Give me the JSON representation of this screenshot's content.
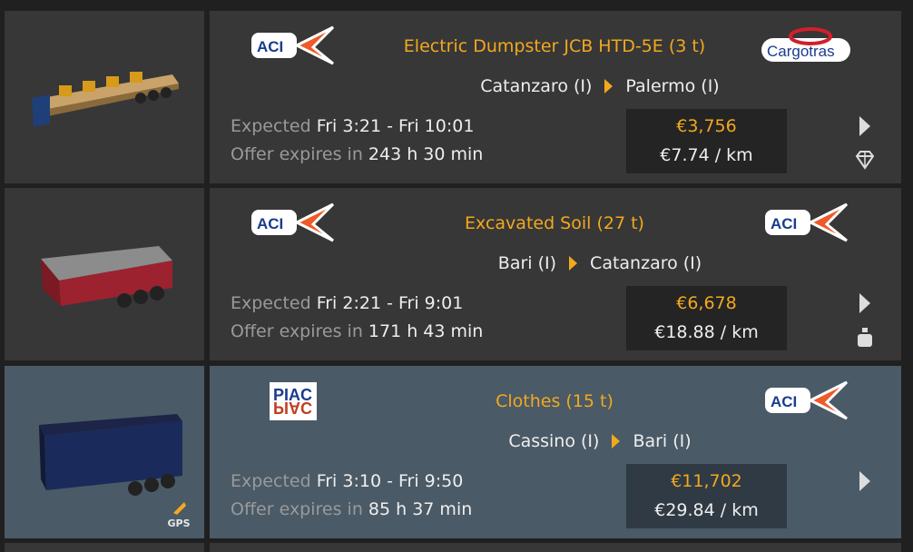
{
  "jobs": [
    {
      "cargo": "Electric Dumpster JCB HTD-5E (3 t)",
      "from": "Catanzaro (I)",
      "to": "Palermo (I)",
      "expected_label": "Expected",
      "expected_value": "Fri 3:21 - Fri 10:01",
      "expires_label": "Offer expires in",
      "expires_value": "243 h 30 min",
      "price": "€3,756",
      "per_km": "€7.74 / km",
      "sender_logo": "ACI",
      "receiver_logo": "Cargotras",
      "trailer_icon": "flatbed-trailer-icon",
      "badge_icon": "diamond-icon"
    },
    {
      "cargo": "Excavated Soil (27 t)",
      "from": "Bari (I)",
      "to": "Catanzaro (I)",
      "expected_label": "Expected",
      "expected_value": "Fri 2:21 - Fri 9:01",
      "expires_label": "Offer expires in",
      "expires_value": "171 h 43 min",
      "price": "€6,678",
      "per_km": "€18.88 / km",
      "sender_logo": "ACI",
      "receiver_logo": "ACI",
      "trailer_icon": "dump-trailer-icon",
      "badge_icon": "heavy-weight-icon"
    },
    {
      "cargo": "Clothes (15 t)",
      "from": "Cassino (I)",
      "to": "Bari (I)",
      "expected_label": "Expected",
      "expected_value": "Fri 3:10 - Fri 9:50",
      "expires_label": "Offer expires in",
      "expires_value": "85 h 37 min",
      "price": "€11,702",
      "per_km": "€29.84 / km",
      "sender_logo": "PIAC",
      "receiver_logo": "ACI",
      "trailer_icon": "curtainside-trailer-icon",
      "gps_label": "GPS",
      "selected": true
    }
  ],
  "colors": {
    "accent": "#f3a81e",
    "card": "#373737",
    "card_selected": "#4a5a67",
    "background": "#202020"
  }
}
